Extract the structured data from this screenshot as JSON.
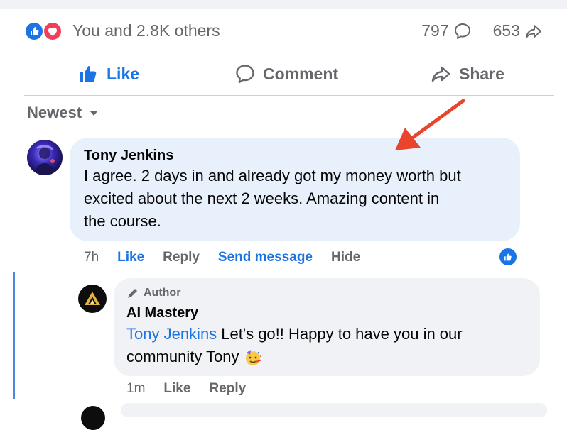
{
  "reactions": {
    "summary": "You and 2.8K others",
    "comment_count": "797",
    "share_count": "653",
    "like_color": "#1b74e4",
    "love_color": "#f33e58"
  },
  "actions": {
    "like": "Like",
    "comment": "Comment",
    "share": "Share"
  },
  "sort": {
    "label": "Newest"
  },
  "comments": [
    {
      "author": "Tony Jenkins",
      "text_line1": "I agree. 2 days in and already got my money worth but",
      "text_line2": "excited about the next 2 weeks. Amazing content in",
      "text_line3": "the course.",
      "time": "7h",
      "actions": [
        "Like",
        "Reply",
        "Send message",
        "Hide"
      ]
    }
  ],
  "reply": {
    "badge": "Author",
    "author": "AI Mastery",
    "mention": "Tony Jenkins",
    "text_line1": " Let's go!! Happy to have you in our",
    "text_line2": "community Tony",
    "time": "1m",
    "actions": [
      "Like",
      "Reply"
    ]
  },
  "colors": {
    "accent": "#1b74e4",
    "annotation_arrow": "#e8452c",
    "comment_bubble": "#e7f0fb",
    "reply_bubble": "#f0f2f5",
    "thread_line": "#4d86d8"
  }
}
